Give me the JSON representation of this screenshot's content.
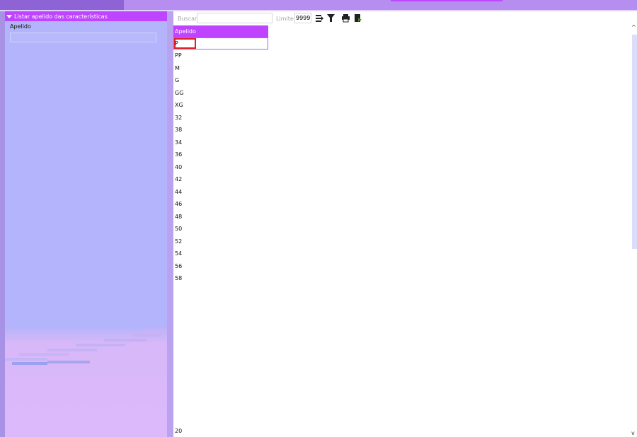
{
  "left_panel": {
    "title": "Listar apelido das características",
    "field_label": "Apelido",
    "field_value": ""
  },
  "toolbar": {
    "search_label": "Buscar",
    "search_value": "",
    "limit_label": "Limite",
    "limit_value": "9999",
    "icons": [
      "sort-icon",
      "filter-icon",
      "print-icon",
      "export-icon"
    ]
  },
  "table": {
    "header": "Apelido",
    "rows": [
      "P",
      "PP",
      "M",
      "G",
      "GG",
      "XG",
      "32",
      "38",
      "34",
      "36",
      "40",
      "42",
      "44",
      "46",
      "48",
      "50",
      "52",
      "54",
      "56",
      "58"
    ],
    "last_row": "20"
  },
  "scrollbar": {
    "up": "^",
    "down": "v"
  },
  "colors": {
    "accent": "#bf44ff",
    "panel": "#b3b4fb",
    "selection_border": "#e02020"
  }
}
